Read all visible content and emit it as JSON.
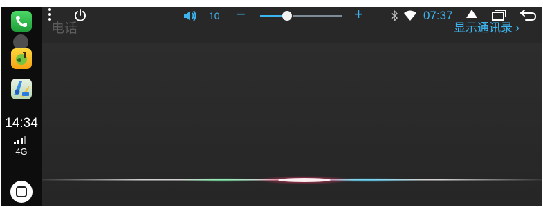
{
  "sidebar": {
    "apps": [
      {
        "name": "phone",
        "icon": "phone-icon"
      },
      {
        "name": "music",
        "icon": "music-icon"
      },
      {
        "name": "maps",
        "icon": "maps-icon"
      }
    ],
    "time": "14:34",
    "signal_bars": 4,
    "network": "4G",
    "home_icon": "home-button-icon"
  },
  "status_bar": {
    "menu_icon": "more-vert-icon",
    "power_icon": "power-icon",
    "volume_icon": "speaker-icon",
    "volume_value": "10",
    "volume_minus": "−",
    "volume_plus": "+",
    "volume_level_fraction": 0.33,
    "bluetooth_icon": "bluetooth-icon",
    "wifi_icon": "wifi-icon",
    "clock": "07:37",
    "up_icon": "eject-up-icon",
    "recent_icon": "recent-apps-icon",
    "back_icon": "back-icon"
  },
  "content": {
    "title": "电话",
    "contacts_link": "显示通讯录",
    "contacts_chevron": "›"
  },
  "colors": {
    "accent": "#3cb4ef",
    "background": "#282828",
    "sidebar": "#0d0d0d"
  }
}
